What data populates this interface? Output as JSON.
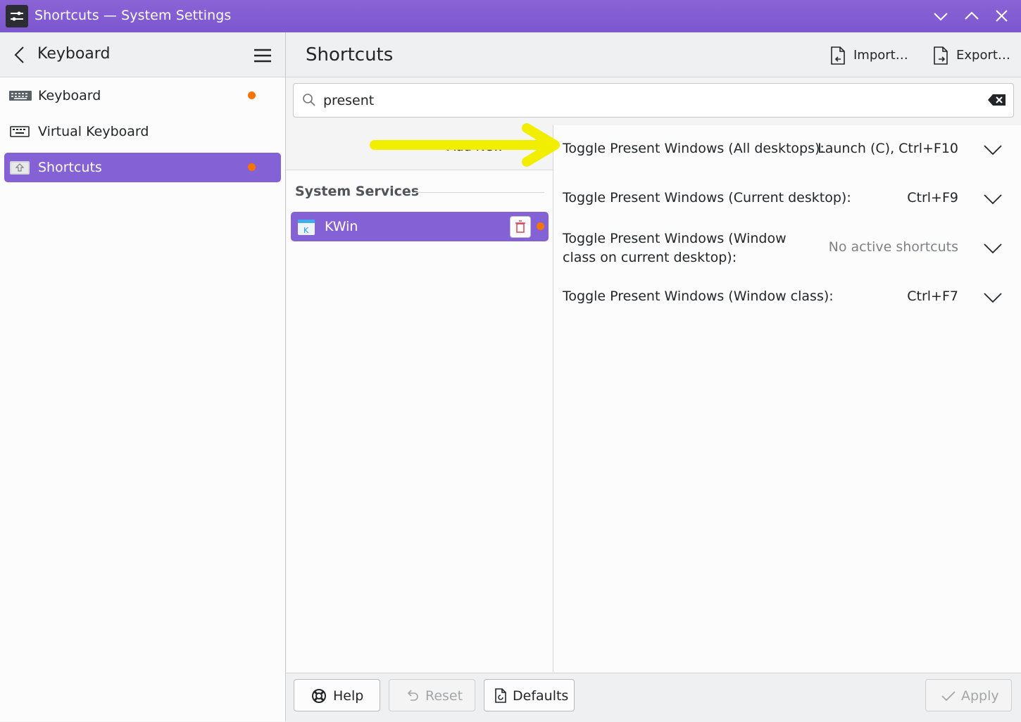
{
  "window": {
    "title": "Shortcuts — System Settings"
  },
  "header": {
    "back_title": "Keyboard",
    "page_title": "Shortcuts",
    "import_label": "Import…",
    "export_label": "Export…"
  },
  "sidebar": {
    "items": [
      {
        "label": "Keyboard",
        "modified": true
      },
      {
        "label": "Virtual Keyboard",
        "modified": false
      },
      {
        "label": "Shortcuts",
        "modified": true,
        "selected": true
      }
    ]
  },
  "search": {
    "value": "present",
    "placeholder": ""
  },
  "components": {
    "add_new_label": "Add New",
    "section_title": "System Services",
    "items": [
      {
        "label": "KWin",
        "selected": true,
        "modified": true
      }
    ]
  },
  "shortcuts": [
    {
      "name": "Toggle Present Windows (All desktops):",
      "keys": "Launch (C), Ctrl+F10"
    },
    {
      "name": "Toggle Present Windows (Current desktop):",
      "keys": "Ctrl+F9"
    },
    {
      "name": "Toggle Present Windows (Window class on current desktop):",
      "keys": "No active shortcuts"
    },
    {
      "name": "Toggle Present Windows (Window class):",
      "keys": "Ctrl+F7"
    }
  ],
  "footer": {
    "help_label": "Help",
    "reset_label": "Reset",
    "defaults_label": "Defaults",
    "apply_label": "Apply"
  },
  "colors": {
    "accent": "#8462d6",
    "titlebar": "#8a63d6",
    "modified_dot": "#f67400",
    "arrow": "#f7f500"
  }
}
